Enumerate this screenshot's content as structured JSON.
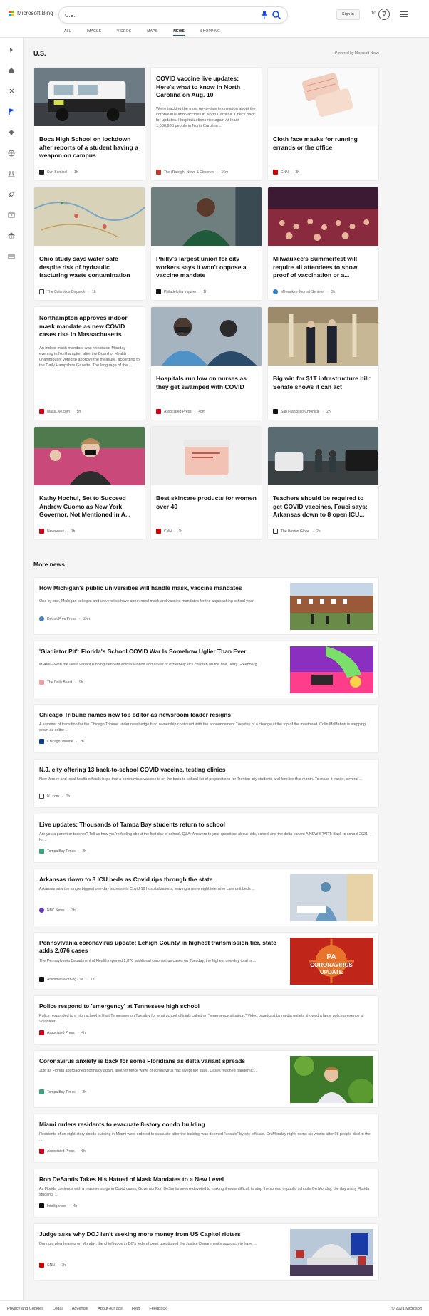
{
  "brand": {
    "logo_text": "Microsoft Bing"
  },
  "search": {
    "query": "U.S."
  },
  "account": {
    "signin_label": "Sign in",
    "points": "10"
  },
  "nav_tabs": [
    "ALL",
    "IMAGES",
    "VIDEOS",
    "MAPS",
    "NEWS",
    "SHOPPING"
  ],
  "active_tab": "NEWS",
  "section": {
    "title": "U.S.",
    "powered_by": "Powered by Microsoft News"
  },
  "top_cards": [
    {
      "title": "Boca High School on lockdown after reports of a student having a weapon on campus",
      "source": "Sun Sentinel",
      "age": "1h"
    },
    {
      "title": "COVID vaccine live updates: Here's what to know in North Carolina on Aug. 10",
      "snippet": "We're tracking the most up-to-date information about the coronavirus and vaccines in North Carolina. Check back for updates. Hospitalizations rise again At least 1,086,938 people in North Carolina ...",
      "source": "The (Raleigh) News & Observer",
      "age": "16m"
    },
    {
      "title": "Cloth face masks for running errands or the office",
      "source": "CNN",
      "age": "3h"
    },
    {
      "title": "Ohio study says water safe despite risk of hydraulic fracturing waste contamination",
      "source": "The Columbus Dispatch",
      "age": "1h"
    },
    {
      "title": "Philly's largest union for city workers says it won't oppose a vaccine mandate",
      "source": "Philadelphia Inquirer",
      "age": "1h"
    },
    {
      "title": "Milwaukee's Summerfest will require all attendees to show proof of vaccination or a...",
      "source": "Milwaukee Journal-Sentinel",
      "age": "3h"
    },
    {
      "title": "Northampton approves indoor mask mandate as new COVID cases rise in Massachusetts",
      "snippet": "An indoor mask mandate was reinstated Monday evening in Northampton after the Board of Health unanimously voted to approve the measure, according to the Daily Hampshire Gazette. The language of the ...",
      "source": "MassLive.com",
      "age": "5h"
    },
    {
      "title": "Hospitals run low on nurses as they get swamped with COVID",
      "source": "Associated Press",
      "age": "48m"
    },
    {
      "title": "Big win for $1T infrastructure bill: Senate shows it can act",
      "source": "San Francisco Chronicle",
      "age": "2h"
    },
    {
      "title": "Kathy Hochul, Set to Succeed Andrew Cuomo as New York Governor, Not Mentioned in A...",
      "source": "Newsweek",
      "age": "1h"
    },
    {
      "title": "Best skincare products for women over 40",
      "source": "CNN",
      "age": "1h"
    },
    {
      "title": "Teachers should be required to get COVID vaccines, Fauci says; Arkansas down to 8 open ICU...",
      "source": "The Boston Globe",
      "age": "2h"
    }
  ],
  "more_news": {
    "title": "More news",
    "items": [
      {
        "title": "How Michigan's public universities will handle mask, vaccine mandates",
        "snippet": "One by one, Michigan colleges and universities have announced mask and vaccine mandates for the approaching school year.",
        "source": "Detroit Free Press",
        "age": "59m"
      },
      {
        "title": "'Gladiator Pit': Florida's School COVID War Is Somehow Uglier Than Ever",
        "snippet": "MIAMI—With the Delta variant running rampant across Florida and cases of extremely sick children on the rise, Jerry Greenberg ...",
        "source": "The Daily Beast",
        "age": "9h"
      },
      {
        "title": "Chicago Tribune names new top editor as newsroom leader resigns",
        "snippet": "A summer of transition for the Chicago Tribune under new hedge fund ownership continued with the announcement Tuesday of a change at the top of the masthead. Colin McMahon is stepping down as editor ...",
        "source": "Chicago Tribune",
        "age": "2h"
      },
      {
        "title": "N.J. city offering 13 back-to-school COVID vaccine, testing clinics",
        "snippet": "New Jersey and local health officials hope that a coronavirus vaccine is on the back-to-school list of preparations for Trenton city students and families this month. To make it easier, several ...",
        "source": "NJ.com",
        "age": "1h"
      },
      {
        "title": "Live updates: Thousands of Tampa Bay students return to school",
        "snippet": "Are you a parent or teacher? Tell us how you're feeling about the first day of school. Q&A: Answers to your questions about kids, school and the delta variant A NEW START: Back to school 2021 — In ...",
        "source": "Tampa Bay Times",
        "age": "2h"
      },
      {
        "title": "Arkansas down to 8 ICU beds as Covid rips through the state",
        "snippet": "Arkansas saw the single biggest one-day increase in Covid-19 hospitalizations, leaving a mere eight intensive care unit beds ...",
        "source": "NBC News",
        "age": "3h"
      },
      {
        "title": "Pennsylvania coronavirus update: Lehigh County in highest transmission tier, state adds 2,076 cases",
        "snippet": "The Pennsylvania Department of Health reported 2,076 additional coronavirus cases on Tuesday, the highest one-day total in ...",
        "source": "Allentown Morning Call",
        "age": "1h",
        "image_text": "PA CORONAVIRUS UPDATE"
      },
      {
        "title": "Police respond to 'emergency' at Tennessee high school",
        "snippet": "Police responded to a high school in East Tennessee on Tuesday for what school officials called an \"emergency situation.\" Video broadcast by media outlets showed a large police presence at Volunteer ...",
        "source": "Associated Press",
        "age": "4h"
      },
      {
        "title": "Coronavirus anxiety is back for some Floridians as delta variant spreads",
        "snippet": "Just as Florida approached normalcy again, another fierce wave of coronavirus has swept the state. Cases reached pandemic ...",
        "source": "Tampa Bay Times",
        "age": "2h"
      },
      {
        "title": "Miami orders residents to evacuate 8-story condo building",
        "snippet": "Residents of an eight-story condo building in Miami were ordered to evacuate after the building was deemed \"unsafe\" by city officials. On Monday night, some six weeks after 98 people died in the ...",
        "source": "Associated Press",
        "age": "6h"
      },
      {
        "title": "Ron DeSantis Takes His Hatred of Mask Mandates to a New Level",
        "snippet": "As Florida contends with a massive surge in Covid cases, Governor Ron DeSantis seems devoted to making it more difficult to stop the spread in public schools.On Monday, the day many Florida students ...",
        "source": "Intelligencer",
        "age": "4h"
      },
      {
        "title": "Judge asks why DOJ isn't seeking more money from US Capitol rioters",
        "snippet": "During a plea hearing on Monday, the chief judge in DC's federal court questioned the Justice Department's approach to have ...",
        "source": "CNN",
        "age": "7h"
      }
    ]
  },
  "footer": {
    "links": [
      "Privacy and Cookies",
      "Legal",
      "Advertise",
      "About our ads",
      "Help",
      "Feedback"
    ],
    "copyright": "© 2021 Microsoft"
  },
  "colors": {
    "accent": "#174ae4",
    "background": "#f5f5f5",
    "card": "#ffffff"
  },
  "icons": [
    "search-icon",
    "microphone-icon",
    "rewards-icon",
    "menu-icon",
    "collapse-icon",
    "home-icon",
    "tech-icon",
    "flag-icon",
    "location-icon",
    "globe-icon",
    "science-icon",
    "rocket-icon",
    "video-icon",
    "bank-icon",
    "creditcard-icon"
  ]
}
